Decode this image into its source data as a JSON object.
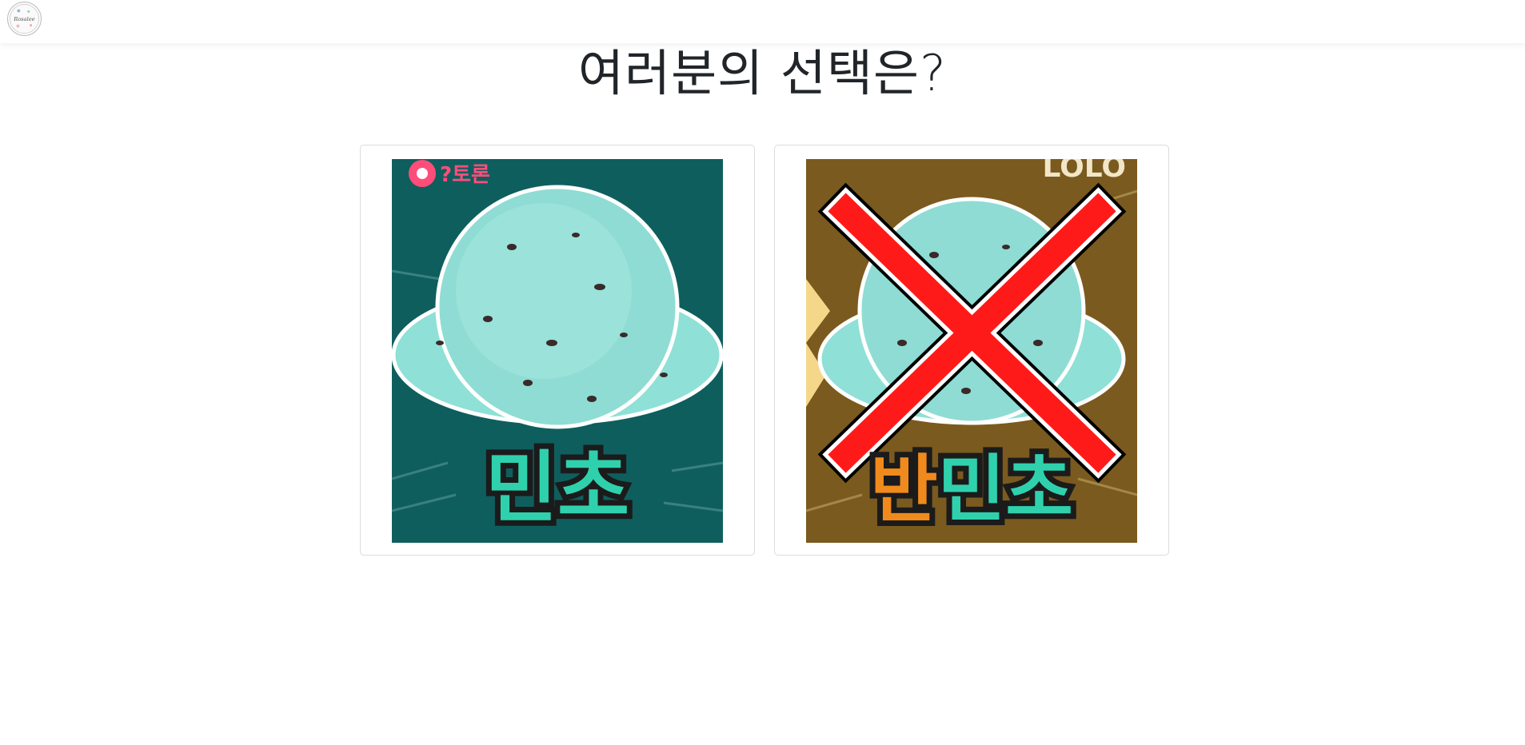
{
  "header": {
    "logo_icon": "circle-brand-logo",
    "logo_text": "Rosalee"
  },
  "main": {
    "title": "여러분의 선택은?"
  },
  "choices": [
    {
      "label": "민초",
      "corner_text": "?토론",
      "background": "#0f5e5e",
      "label_color": "#2fd1ad",
      "has_x_mark": false
    },
    {
      "label_prefix": "반",
      "label_suffix": "민초",
      "corner_text": "LOLO",
      "background": "#7a5a1e",
      "prefix_color": "#f08a1c",
      "label_color": "#2fd1ad",
      "x_mark_color": "#ff1a1a",
      "has_x_mark": true
    }
  ]
}
